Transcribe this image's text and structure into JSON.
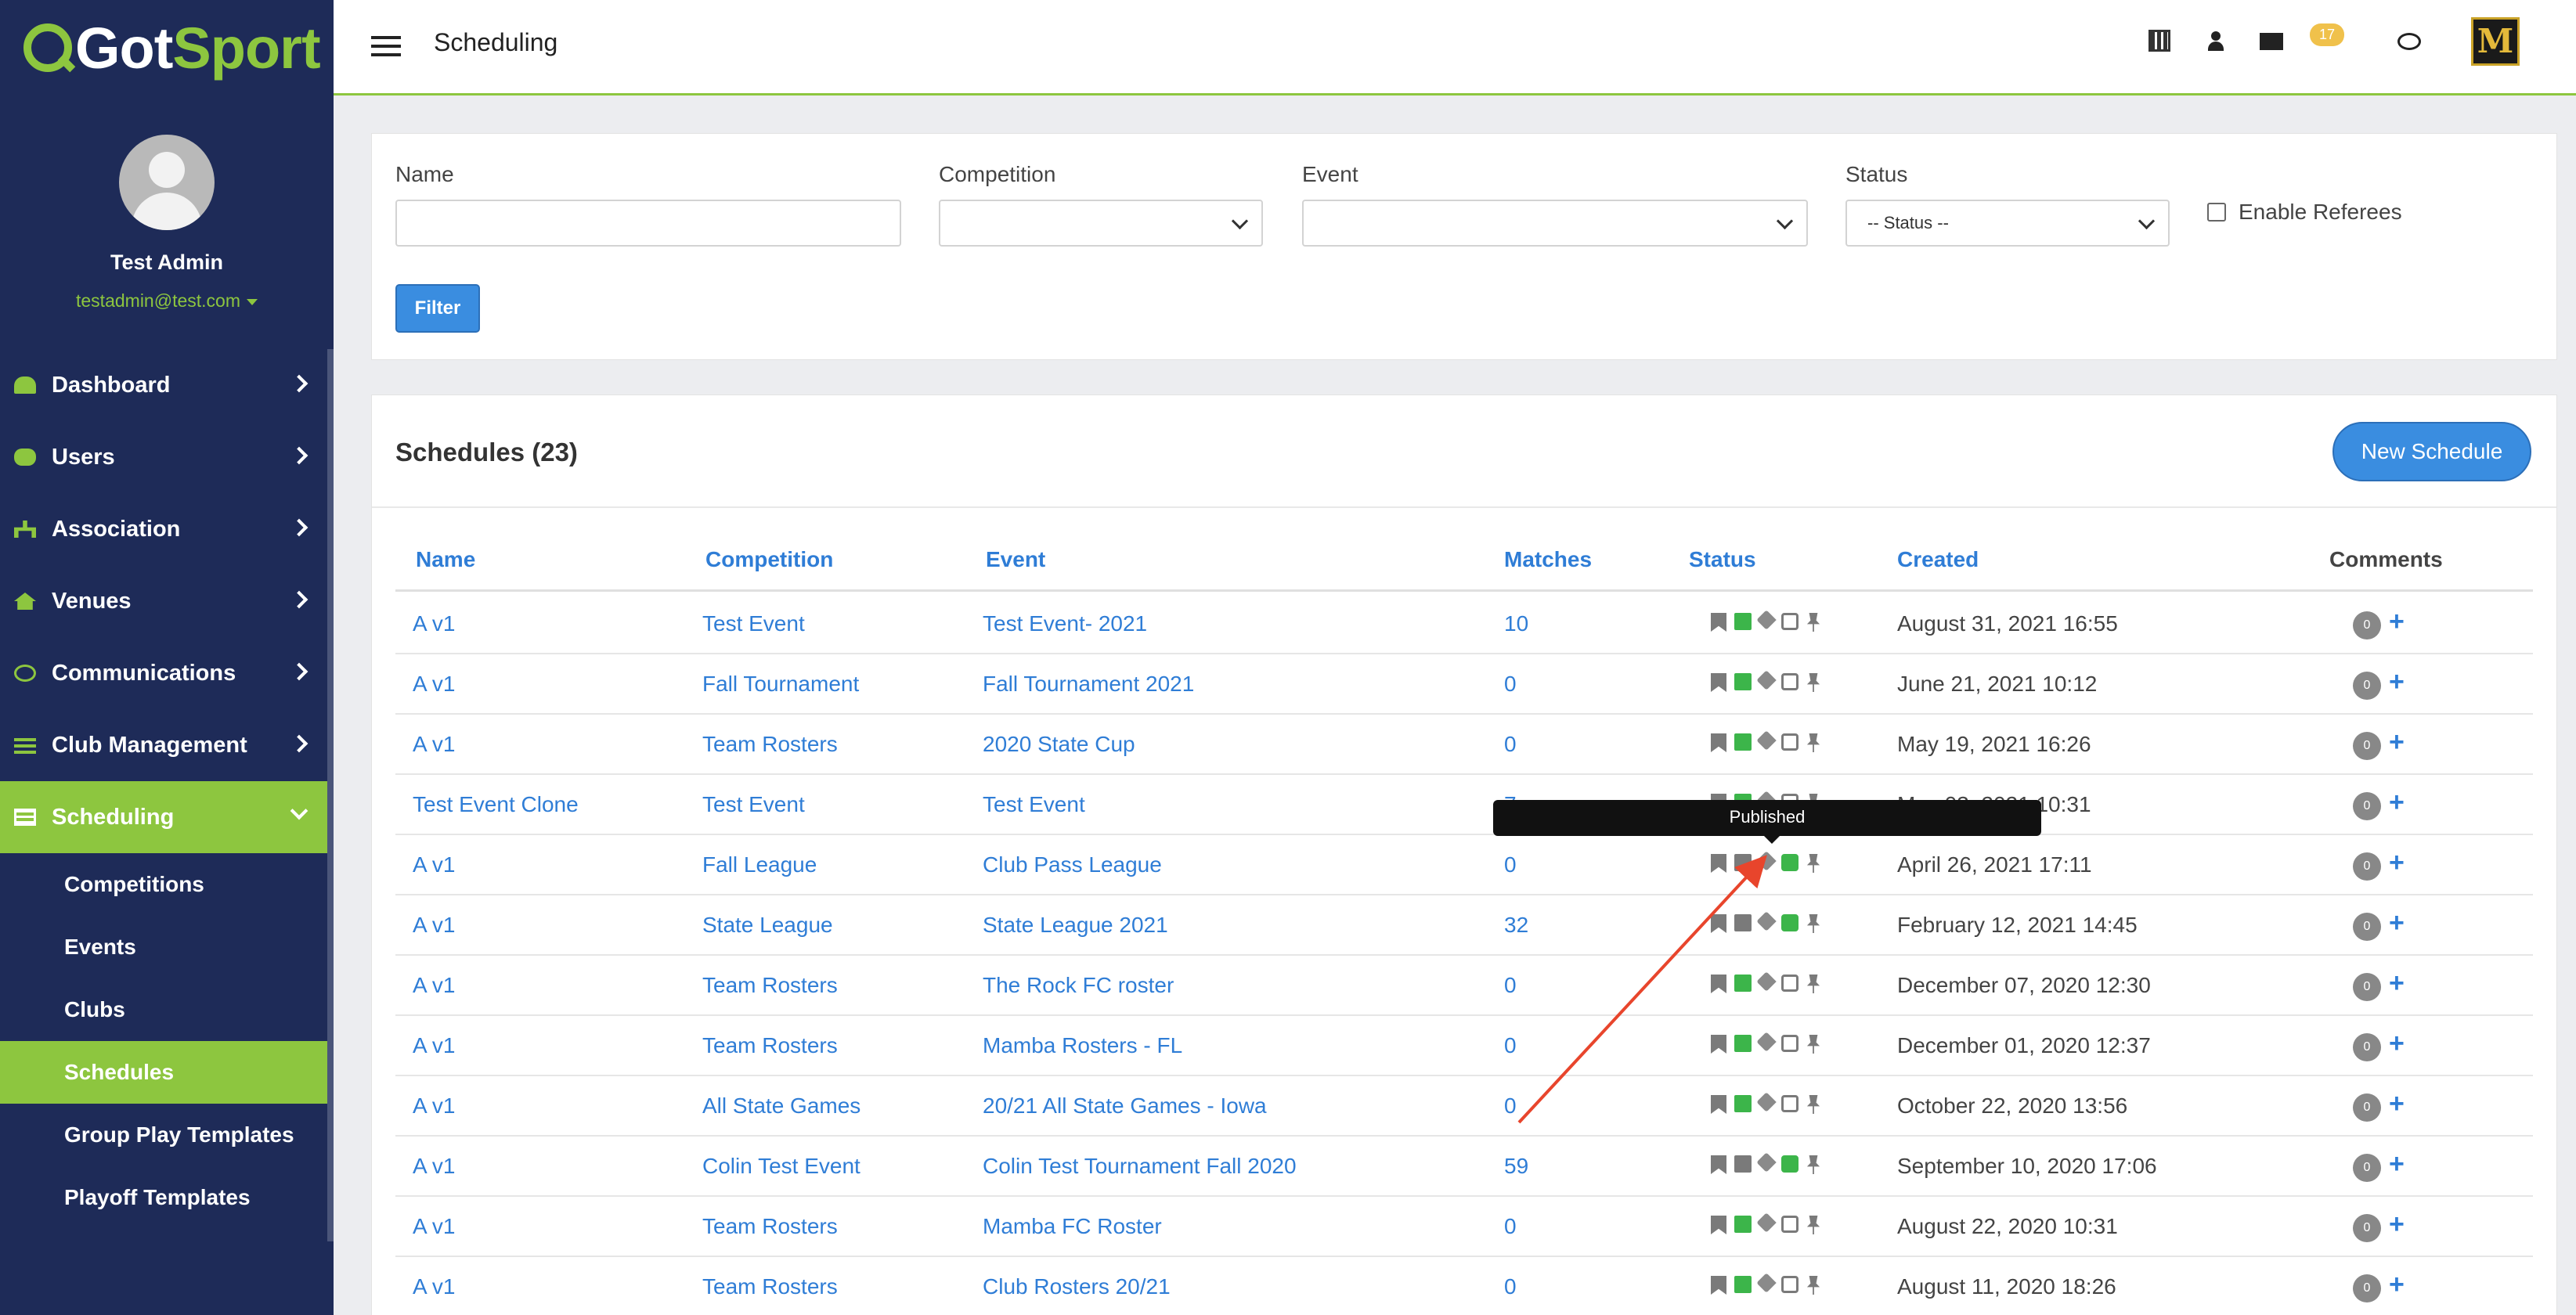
{
  "brand": {
    "name_part1": "Got",
    "name_part2": "Sport",
    "accent": "#8dc63f",
    "navy": "#1e2b58"
  },
  "profile": {
    "name": "Test Admin",
    "email": "testadmin@test.com"
  },
  "nav": {
    "items": [
      {
        "label": "Dashboard",
        "icon": "dashboard-icon"
      },
      {
        "label": "Users",
        "icon": "users-icon"
      },
      {
        "label": "Association",
        "icon": "sitemap-icon"
      },
      {
        "label": "Venues",
        "icon": "home-icon"
      },
      {
        "label": "Communications",
        "icon": "chat-icon"
      },
      {
        "label": "Club Management",
        "icon": "list-icon"
      },
      {
        "label": "Scheduling",
        "icon": "calendar-icon"
      }
    ],
    "sub": [
      "Competitions",
      "Events",
      "Clubs",
      "Schedules",
      "Group Play Templates",
      "Playoff Templates"
    ]
  },
  "topbar": {
    "title": "Scheduling",
    "mail_count": "17",
    "brand_letter": "M"
  },
  "filters": {
    "name_label": "Name",
    "competition_label": "Competition",
    "event_label": "Event",
    "status_label": "Status",
    "status_value": "-- Status --",
    "referees_label": "Enable Referees",
    "filter_button": "Filter"
  },
  "schedules": {
    "title": "Schedules (23)",
    "new_button": "New Schedule",
    "columns": [
      "Name",
      "Competition",
      "Event",
      "Matches",
      "Status",
      "Created",
      "Comments"
    ],
    "tooltip": "Published",
    "rows": [
      {
        "name": "A v1",
        "competition": "Test Event",
        "event": "Test Event- 2021",
        "matches": "10",
        "created": "August 31, 2021 16:55",
        "comments": "0",
        "published": false
      },
      {
        "name": "A v1",
        "competition": "Fall Tournament",
        "event": "Fall Tournament 2021",
        "matches": "0",
        "created": "June 21, 2021 10:12",
        "comments": "0",
        "published": false
      },
      {
        "name": "A v1",
        "competition": "Team Rosters",
        "event": "2020 State Cup",
        "matches": "0",
        "created": "May 19, 2021 16:26",
        "comments": "0",
        "published": false
      },
      {
        "name": "Test Event Clone",
        "competition": "Test Event",
        "event": "Test Event",
        "matches": "7",
        "created": "May 03, 2021 10:31",
        "comments": "0",
        "published": false
      },
      {
        "name": "A v1",
        "competition": "Fall League",
        "event": "Club Pass League",
        "matches": "0",
        "created": "April 26, 2021 17:11",
        "comments": "0",
        "published": true
      },
      {
        "name": "A v1",
        "competition": "State League",
        "event": "State League 2021",
        "matches": "32",
        "created": "February 12, 2021 14:45",
        "comments": "0",
        "published": true
      },
      {
        "name": "A v1",
        "competition": "Team Rosters",
        "event": "The Rock FC roster",
        "matches": "0",
        "created": "December 07, 2020 12:30",
        "comments": "0",
        "published": false
      },
      {
        "name": "A v1",
        "competition": "Team Rosters",
        "event": "Mamba Rosters - FL",
        "matches": "0",
        "created": "December 01, 2020 12:37",
        "comments": "0",
        "published": false
      },
      {
        "name": "A v1",
        "competition": "All State Games",
        "event": "20/21 All State Games - Iowa",
        "matches": "0",
        "created": "October 22, 2020 13:56",
        "comments": "0",
        "published": false
      },
      {
        "name": "A v1",
        "competition": "Colin Test Event",
        "event": "Colin Test Tournament Fall 2020",
        "matches": "59",
        "created": "September 10, 2020 17:06",
        "comments": "0",
        "published": true
      },
      {
        "name": "A v1",
        "competition": "Team Rosters",
        "event": "Mamba FC Roster",
        "matches": "0",
        "created": "August 22, 2020 10:31",
        "comments": "0",
        "published": false
      },
      {
        "name": "A v1",
        "competition": "Team Rosters",
        "event": "Club Rosters 20/21",
        "matches": "0",
        "created": "August 11, 2020 18:26",
        "comments": "0",
        "published": false
      }
    ]
  }
}
